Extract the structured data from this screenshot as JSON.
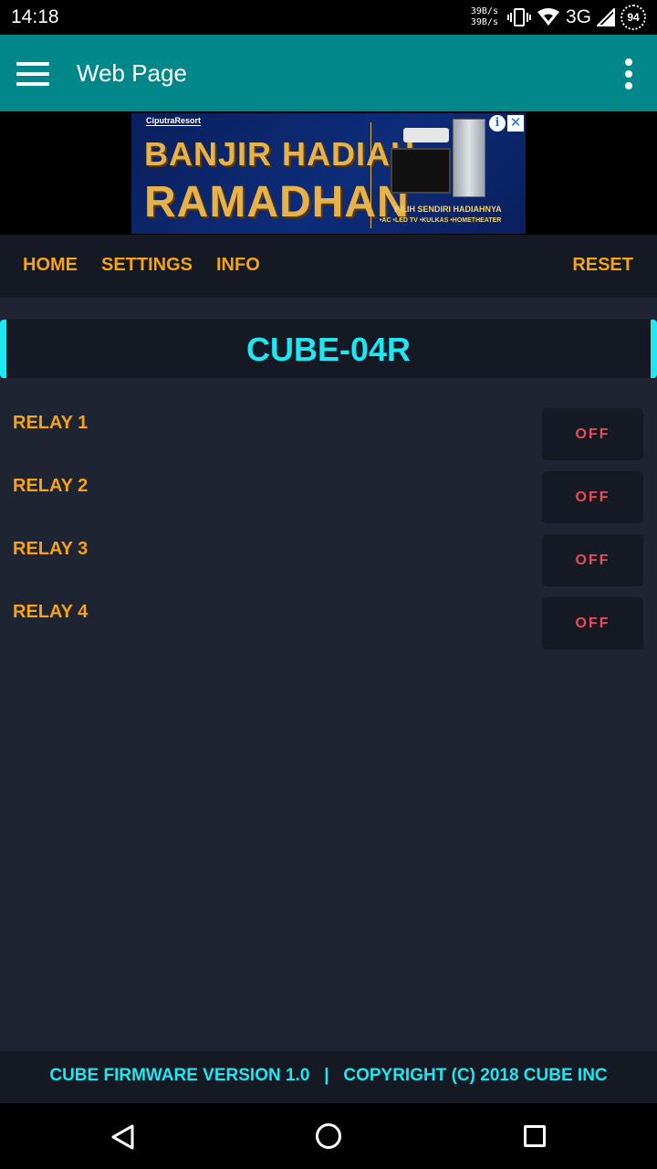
{
  "status_bar": {
    "time": "14:18",
    "net_speed_up": "39B/s",
    "net_speed_down": "39B/s",
    "network": "3G",
    "battery": "94"
  },
  "app_bar": {
    "title": "Web Page",
    "menu_icon": "hamburger-menu-icon",
    "overflow_icon": "more-vert-icon"
  },
  "ad": {
    "brand": "CiputraResort",
    "headline_line1": "BANJIR HADIAH",
    "headline_line2": "RAMADHAN",
    "tagline": "PILIH SENDIRI HADIAHNYA",
    "products": "•AC •LED TV •KULKAS •HOMETHEATER",
    "info_icon": "i",
    "close_icon": "✕"
  },
  "nav": {
    "home": "HOME",
    "settings": "SETTINGS",
    "info": "INFO",
    "reset": "RESET"
  },
  "device": {
    "title": "CUBE-04R"
  },
  "relays": [
    {
      "label": "RELAY 1",
      "state": "OFF"
    },
    {
      "label": "RELAY 2",
      "state": "OFF"
    },
    {
      "label": "RELAY 3",
      "state": "OFF"
    },
    {
      "label": "RELAY 4",
      "state": "OFF"
    }
  ],
  "footer": {
    "text": "CUBE FIRMWARE VERSION 1.0   |   COPYRIGHT (C) 2018 CUBE INC"
  },
  "colors": {
    "app_bar": "#00878a",
    "accent_orange": "#f4a31a",
    "accent_cyan": "#1ee7f2",
    "off_red": "#ee4b5a",
    "background": "#1f2433",
    "panel": "#141923"
  }
}
